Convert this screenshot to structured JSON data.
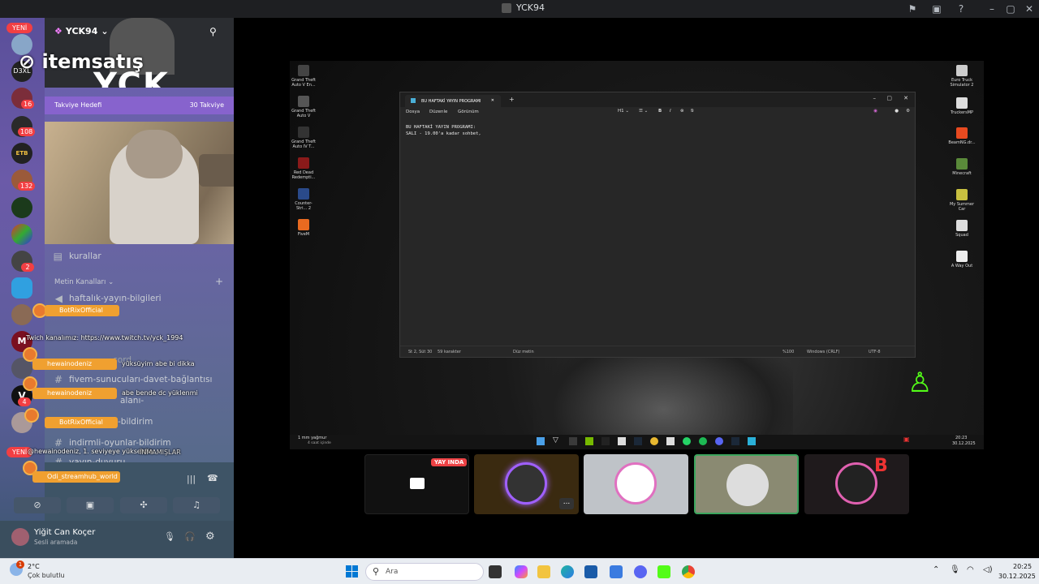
{
  "window": {
    "title": "YCK94"
  },
  "rail": {
    "new_label": "YENİ",
    "servers": [
      {
        "name": "D3XL"
      },
      {
        "name": "16",
        "badge": "16"
      },
      {
        "name": "GILDED",
        "badge": "108"
      },
      {
        "name": "ETB"
      },
      {
        "name": "132",
        "badge": "132"
      },
      {
        "name": "green"
      },
      {
        "name": "mixed"
      },
      {
        "name": "2",
        "badge": "2"
      },
      {
        "name": "blue"
      },
      {
        "name": "avatar1"
      },
      {
        "name": "M"
      },
      {
        "name": "avatar2"
      },
      {
        "name": "V",
        "badge": "4"
      },
      {
        "name": "avatar3"
      }
    ]
  },
  "sidebar": {
    "server_name": "YCK94",
    "watermark": "itemsatış",
    "banner_text": "YCK",
    "boost_left": "Takviye Hedefi",
    "boost_right": "30 Takviye",
    "channel_rules": "kurallar",
    "category_text": "Metin Kanalları",
    "channels": [
      "haftalık-yayın-bilgileri",
      "fivem-sunucuları-davet-bağlantısı",
      "indirmli-oyunlar-bildirim",
      "yayın-duyuru"
    ],
    "partial_channels": [
      "cord",
      "alanı-",
      "-bildirim"
    ],
    "voice_status": "Ses Bağlandı",
    "voice_buttons": [
      "camera-off",
      "screen",
      "activities",
      "soundboard"
    ],
    "user_name": "Yiğit Can Koçer",
    "user_status": "Sesli aramada"
  },
  "overlay_chat": [
    {
      "user": "BotRixOfficial",
      "text": ""
    },
    {
      "user": "",
      "text": "Twich kanalımız: https://www.twitch.tv/yck_1994"
    },
    {
      "user": "hewainodeniz",
      "text": "yüksüyim abe bi dikka"
    },
    {
      "user": "hewainodeniz",
      "text": "abe bende dc yüklenmi"
    },
    {
      "user": "BotRixOfficial",
      "text": ""
    },
    {
      "user": "",
      "text": "@hewainodeniz, 1. seviyeye yükseldin"
    },
    {
      "user": "Odi_streamhub_world",
      "text": ""
    }
  ],
  "overlay_misc": {
    "hidden_label": "İNMAMIŞLAR",
    "new_label": "YENİ"
  },
  "desktop_icons_left": [
    "Grand Theft Auto V En...",
    "Grand Theft Auto V",
    "Grand Theft Auto IV T...",
    "Red Dead Redempti...",
    "Counter-Stri... 2",
    "FiveM"
  ],
  "desktop_icons_right": [
    "Euro Truck Simulator 2",
    "TruckersMP",
    "BeamNG.dr...",
    "Minecraft",
    "My Summer Car",
    "Squad",
    "A Way Out"
  ],
  "notepad": {
    "tab_title": "BU HAFTAKİ YAYIN PROGRAMI",
    "menu": [
      "Dosya",
      "Düzenle",
      "Görünüm"
    ],
    "line1": "BU HAFTAKİ YAYIN PROGRAMI:",
    "line2": "SALI - 19.00'a kadar sohbet,",
    "status_pos": "St 2, Süt 30",
    "status_chars": "59 karakter",
    "status_mode": "Düz metin",
    "status_zoom": "%100",
    "status_eol": "Windows (CRLF)",
    "status_enc": "UTF-8"
  },
  "remote_taskbar": {
    "weather": "1 mm yağmur",
    "weather_sub": "4 saat içinde",
    "time": "20:23",
    "date": "30.12.2025"
  },
  "tiles": {
    "live_badge": "YAY INDA",
    "more_label": "..."
  },
  "taskbar": {
    "temp": "2°C",
    "weather": "Çok bulutlu",
    "weather_badge": "1",
    "search_placeholder": "Ara",
    "time": "20:25",
    "date": "30.12.2025"
  },
  "colors": {
    "accent": "#5865f2",
    "danger": "#f23f43",
    "live": "#ed4245",
    "chat_orange": "#f0a030"
  }
}
